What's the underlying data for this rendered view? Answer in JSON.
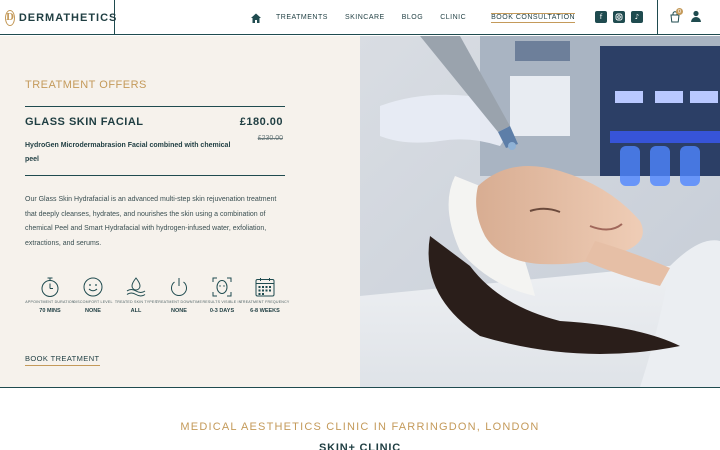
{
  "brand": {
    "name": "DERMATHETICS",
    "logo_letter": "D",
    "accent": "#c49a5a",
    "primary": "#1f4b4f"
  },
  "nav": {
    "home_icon": "home-icon",
    "items": [
      {
        "label": "TREATMENTS"
      },
      {
        "label": "SKINCARE"
      },
      {
        "label": "BLOG"
      },
      {
        "label": "CLINIC"
      }
    ],
    "cta": "BOOK CONSULTATION"
  },
  "header": {
    "socials": [
      "facebook-icon",
      "instagram-icon",
      "tiktok-icon"
    ],
    "cart_count": "0",
    "cart_icon": "cart-icon",
    "user_icon": "user-icon"
  },
  "offer": {
    "section_title": "TREATMENT OFFERS",
    "name": "GLASS SKIN FACIAL",
    "price": "£180.00",
    "old_price": "£230.00",
    "subtitle": "HydroGen Microdermabrasion Facial combined with chemical peel",
    "description": "Our Glass Skin Hydrafacial is an advanced multi-step skin rejuvenation treatment that deeply cleanses, hydrates, and nourishes the skin using a combination of chemical Peel and Smart Hydrafacial with hydrogen-infused water, exfoliation, extractions, and serums.",
    "stats": [
      {
        "icon": "stopwatch-icon",
        "label": "APPOINTMENT DURATION",
        "value": "70 MINS"
      },
      {
        "icon": "smiley-icon",
        "label": "DISCOMFORT LEVEL",
        "value": "NONE"
      },
      {
        "icon": "water-drop-icon",
        "label": "TREATED SKIN TYPES",
        "value": "ALL"
      },
      {
        "icon": "power-icon",
        "label": "TREATMENT DOWNTIME",
        "value": "NONE"
      },
      {
        "icon": "face-scan-icon",
        "label": "RESULTS VISIBLE IN",
        "value": "0-3 DAYS"
      },
      {
        "icon": "calendar-icon",
        "label": "TREATMENT FREQUENCY",
        "value": "6-8 WEEKS"
      }
    ],
    "book_label": "BOOK TREATMENT"
  },
  "clinic": {
    "heading": "MEDICAL AESTHETICS CLINIC IN FARRINGDON, LONDON",
    "subheading": "SKIN+ CLINIC"
  }
}
